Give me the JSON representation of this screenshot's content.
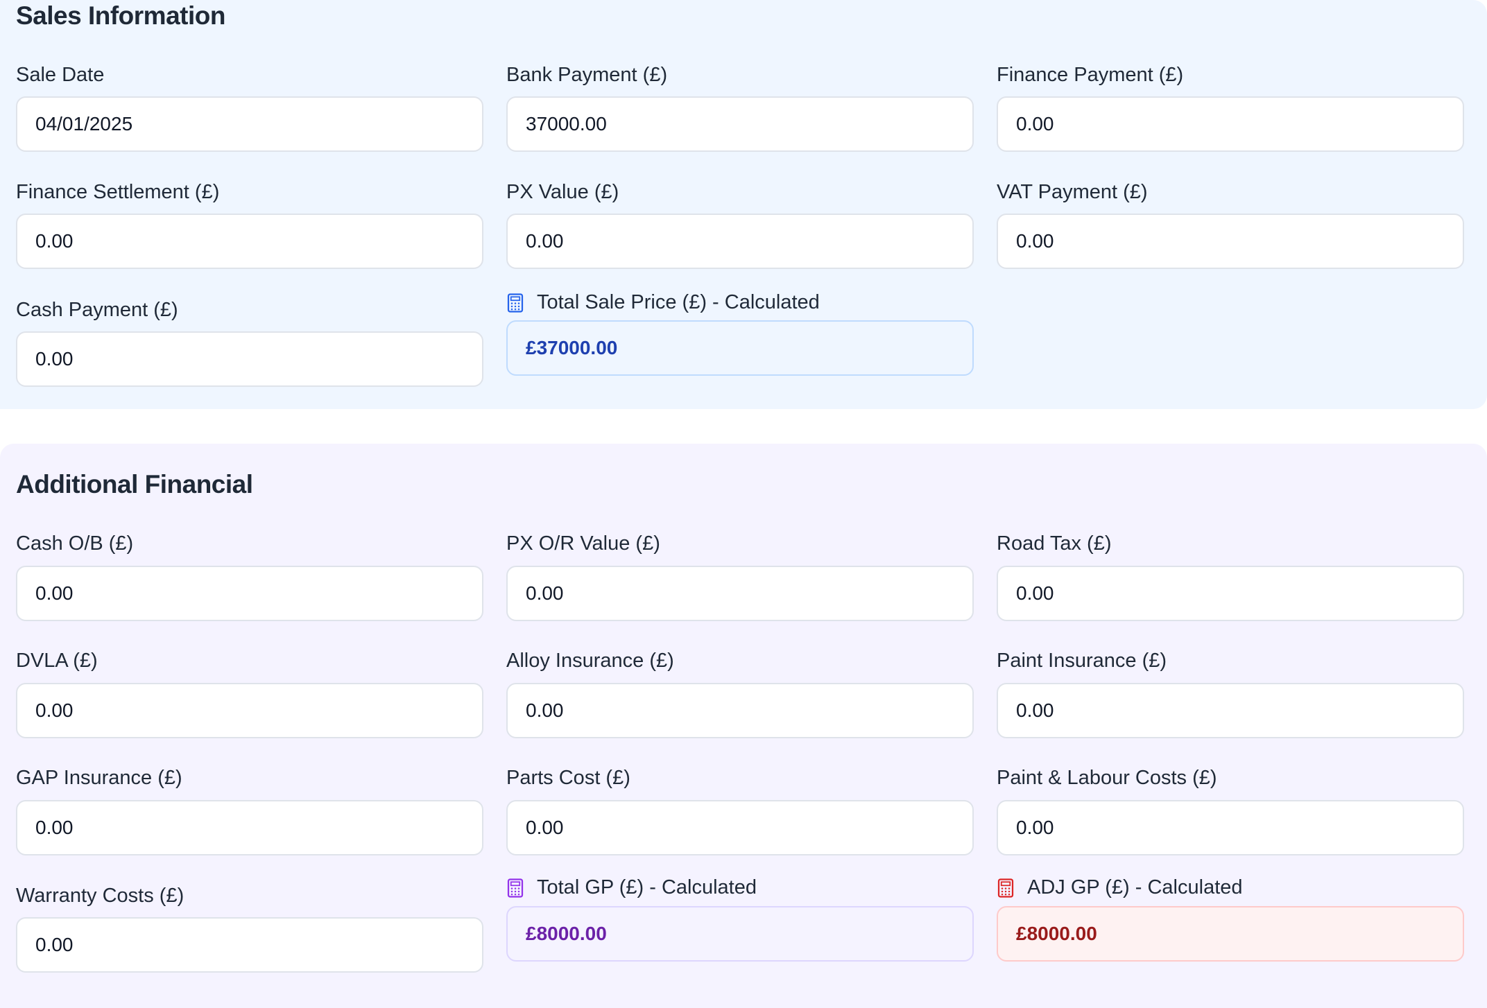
{
  "sales": {
    "title": "Sales Information",
    "sale_date": {
      "label": "Sale Date",
      "value": "04/01/2025"
    },
    "bank_payment": {
      "label": "Bank Payment (£)",
      "value": "37000.00"
    },
    "finance_payment": {
      "label": "Finance Payment (£)",
      "value": "0.00"
    },
    "finance_settlement": {
      "label": "Finance Settlement (£)",
      "value": "0.00"
    },
    "px_value": {
      "label": "PX Value (£)",
      "value": "0.00"
    },
    "vat_payment": {
      "label": "VAT Payment (£)",
      "value": "0.00"
    },
    "cash_payment": {
      "label": "Cash Payment (£)",
      "value": "0.00"
    },
    "total_sale_price": {
      "label": "Total Sale Price (£) - Calculated",
      "value": "£37000.00",
      "icon": "calculator-icon",
      "color": "#1e40af"
    }
  },
  "additional": {
    "title": "Additional Financial",
    "cash_ob": {
      "label": "Cash O/B (£)",
      "value": "0.00"
    },
    "px_or_value": {
      "label": "PX O/R Value (£)",
      "value": "0.00"
    },
    "road_tax": {
      "label": "Road Tax (£)",
      "value": "0.00"
    },
    "dvla": {
      "label": "DVLA (£)",
      "value": "0.00"
    },
    "alloy_insurance": {
      "label": "Alloy Insurance (£)",
      "value": "0.00"
    },
    "paint_insurance": {
      "label": "Paint Insurance (£)",
      "value": "0.00"
    },
    "gap_insurance": {
      "label": "GAP Insurance (£)",
      "value": "0.00"
    },
    "parts_cost": {
      "label": "Parts Cost (£)",
      "value": "0.00"
    },
    "paint_labour_costs": {
      "label": "Paint & Labour Costs (£)",
      "value": "0.00"
    },
    "warranty_costs": {
      "label": "Warranty Costs (£)",
      "value": "0.00"
    },
    "total_gp": {
      "label": "Total GP (£) - Calculated",
      "value": "£8000.00",
      "icon": "calculator-icon",
      "color": "#6b21a8"
    },
    "adj_gp": {
      "label": "ADJ GP (£) - Calculated",
      "value": "£8000.00",
      "icon": "calculator-icon",
      "color": "#991b1b"
    }
  }
}
